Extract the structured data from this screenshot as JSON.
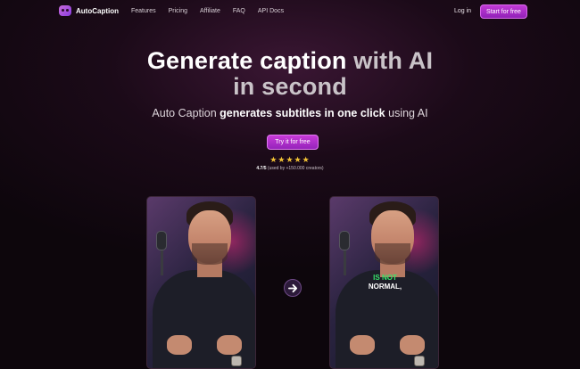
{
  "nav": {
    "logo_text": "AutoCaption",
    "links": [
      "Features",
      "Pricing",
      "Affiliate",
      "FAQ",
      "API Docs"
    ],
    "login": "Log in",
    "cta": "Start for free"
  },
  "hero": {
    "title_line1_a": "Generate caption ",
    "title_line1_b": "with AI",
    "title_line2": "in second",
    "subtitle_a": "Auto Caption ",
    "subtitle_b": "generates subtitles in one click",
    "subtitle_c": " using AI",
    "cta": "Try it for free",
    "stars": "★★★★★",
    "rating_value": "4.7/5",
    "rating_note": " (used by +150.000 creators)"
  },
  "demo": {
    "caption_line1": "IS NOT",
    "caption_line2": "NORMAL,"
  },
  "icons": {
    "logo": "logo-mask-icon",
    "arrow": "arrow-right-icon"
  },
  "colors": {
    "accent": "#b42ed0",
    "star": "#f2c335",
    "caption_highlight": "#37e36a"
  }
}
